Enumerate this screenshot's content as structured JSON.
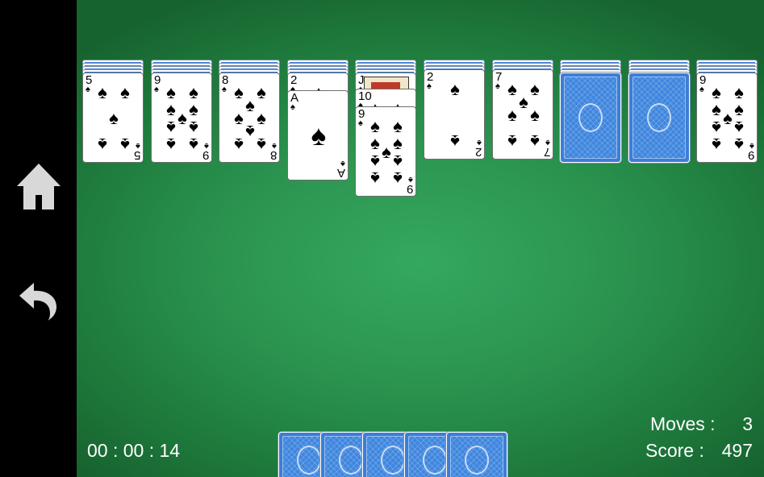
{
  "sidebar": {
    "home_icon": "home-icon",
    "undo_icon": "undo-icon"
  },
  "status": {
    "timer": "00 : 00 : 14",
    "moves_label": "Moves :",
    "moves_value": "3",
    "score_label": "Score :",
    "score_value": "497"
  },
  "colors": {
    "felt": "#2b9550",
    "card_back": "#3c7ed6",
    "sidebar": "#000000"
  },
  "tableau": [
    {
      "hidden": 4,
      "faceup": [
        {
          "rank": "5",
          "suit": "♠"
        }
      ]
    },
    {
      "hidden": 4,
      "faceup": [
        {
          "rank": "9",
          "suit": "♠"
        }
      ]
    },
    {
      "hidden": 4,
      "faceup": [
        {
          "rank": "8",
          "suit": "♠"
        }
      ]
    },
    {
      "hidden": 4,
      "faceup": [
        {
          "rank": "2",
          "suit": "♠"
        },
        {
          "rank": "A",
          "suit": "♠"
        }
      ]
    },
    {
      "hidden": 4,
      "faceup": [
        {
          "rank": "J",
          "suit": "♠"
        },
        {
          "rank": "10",
          "suit": "♠"
        },
        {
          "rank": "9",
          "suit": "♠"
        }
      ]
    },
    {
      "hidden": 3,
      "faceup": [
        {
          "rank": "2",
          "suit": "♠"
        }
      ]
    },
    {
      "hidden": 3,
      "faceup": [
        {
          "rank": "7",
          "suit": "♠"
        }
      ]
    },
    {
      "hidden": 4,
      "faceup": []
    },
    {
      "hidden": 4,
      "faceup": []
    },
    {
      "hidden": 4,
      "faceup": [
        {
          "rank": "9",
          "suit": "♠"
        }
      ]
    }
  ],
  "stock": {
    "remaining_deals": 5
  }
}
